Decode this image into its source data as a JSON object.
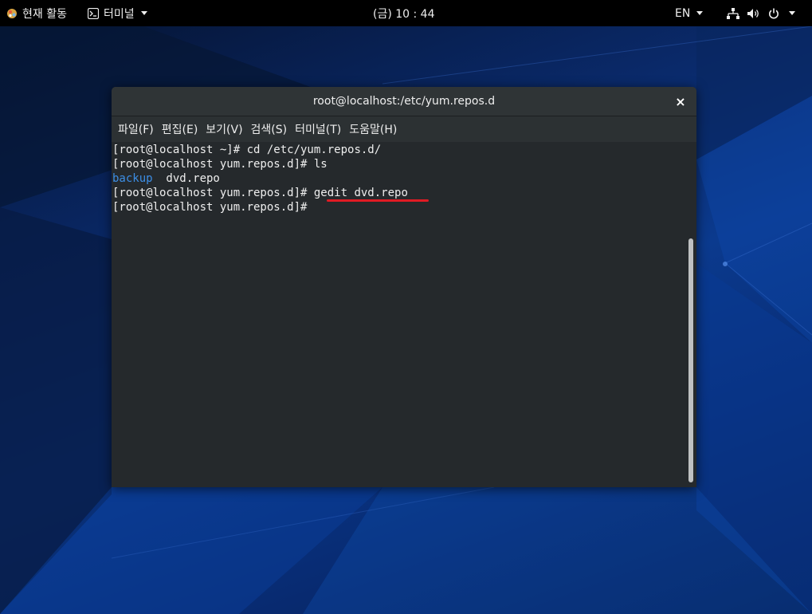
{
  "topbar": {
    "activities": "현재 활동",
    "app_menu": "터미널",
    "clock": "(금) 10 : 44",
    "input_method": "EN"
  },
  "window": {
    "title": "root@localhost:/etc/yum.repos.d",
    "close_glyph": "×"
  },
  "menubar": {
    "items": [
      "파일(F)",
      "편집(E)",
      "보기(V)",
      "검색(S)",
      "터미널(T)",
      "도움말(H)"
    ]
  },
  "terminal": {
    "lines": [
      {
        "prompt": "[root@localhost ~]# ",
        "command": "cd /etc/yum.repos.d/"
      },
      {
        "prompt": "[root@localhost yum.repos.d]# ",
        "command": "ls"
      },
      {
        "dir": "backup",
        "file": "  dvd.repo"
      },
      {
        "prompt": "[root@localhost yum.repos.d]# ",
        "command": "gedit dvd.repo"
      },
      {
        "prompt": "[root@localhost yum.repos.d]# ",
        "command": ""
      }
    ]
  },
  "colors": {
    "dir_blue": "#3c8ee6",
    "highlight_red": "#e01b24",
    "terminal_bg": "#25292c"
  }
}
